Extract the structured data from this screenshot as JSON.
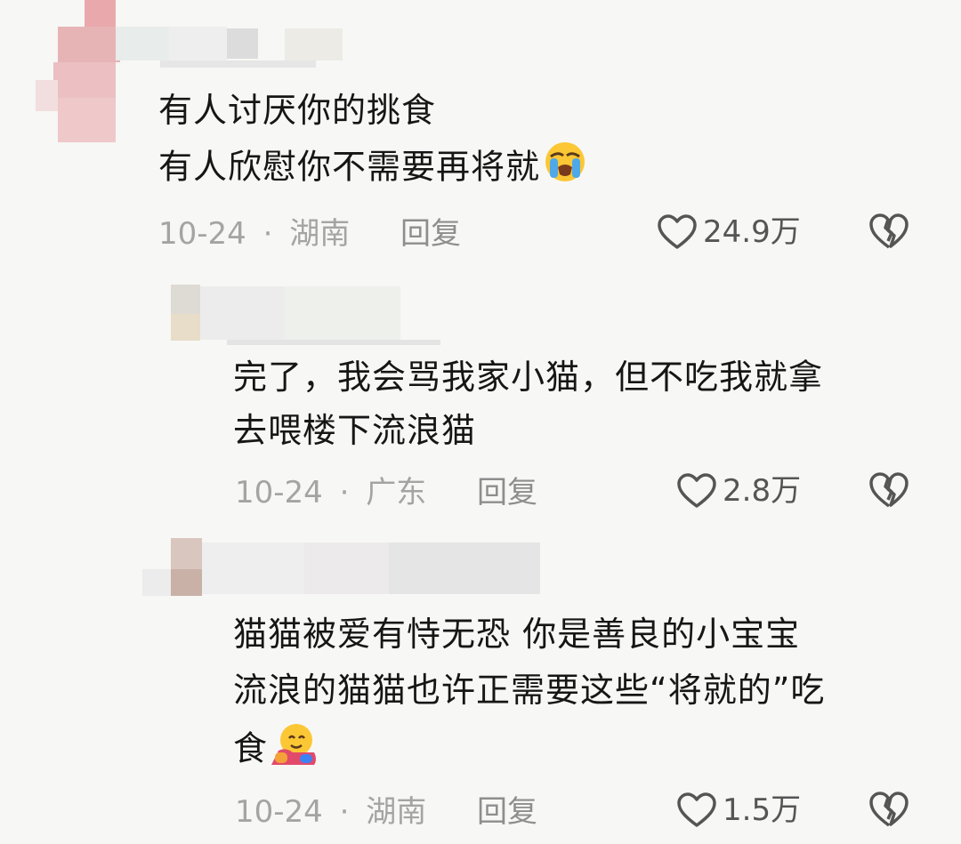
{
  "comments": [
    {
      "line1": "有人讨厌你的挑食",
      "line2": "有人欣慰你不需要再将就",
      "emoji": "loudly-crying-face",
      "date": "10-24",
      "location": "湖南",
      "reply_label": "回复",
      "likes": "24.9万"
    },
    {
      "line1": "完了，我会骂我家小猫，但不吃我就拿",
      "line2": "去喂楼下流浪猫",
      "date": "10-24",
      "location": "广东",
      "reply_label": "回复",
      "likes": "2.8万"
    },
    {
      "line1": "猫猫被爱有恃无恐 你是善良的小宝宝",
      "line2": "流浪的猫猫也许正需要这些“将就的”吃",
      "line3": "食",
      "emoji": "hugging-face",
      "date": "10-24",
      "location": "湖南",
      "reply_label": "回复",
      "likes": "1.5万"
    }
  ],
  "meta_separator": "·",
  "colors": {
    "background": "#f7f7f5",
    "text": "#161616",
    "meta": "#a4a4a4",
    "icon": "#555555"
  }
}
